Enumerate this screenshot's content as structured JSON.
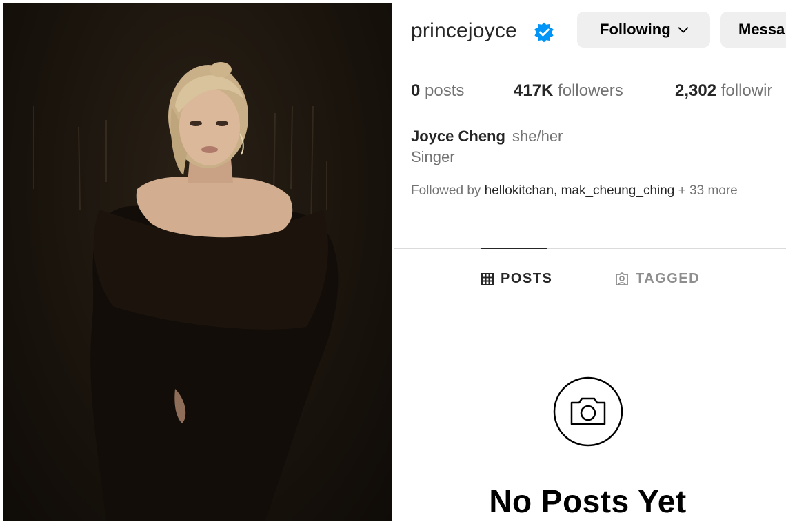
{
  "profile": {
    "username": "princejoyce",
    "verified": true,
    "buttons": {
      "following": "Following",
      "message": "Messa"
    },
    "stats": [
      {
        "value": "0",
        "label": "posts"
      },
      {
        "value": "417K",
        "label": "followers"
      },
      {
        "value": "2,302",
        "label": "followir"
      }
    ],
    "full_name": "Joyce Cheng",
    "pronouns": "she/her",
    "category": "Singer",
    "followed_by": {
      "prefix": "Followed by",
      "users": [
        "hellokitchan",
        "mak_cheung_ching"
      ],
      "separator": ",",
      "more": "+ 33 more"
    }
  },
  "tabs": [
    {
      "label": "POSTS",
      "icon": "grid-icon",
      "active": true
    },
    {
      "label": "TAGGED",
      "icon": "tagged-person-icon",
      "active": false
    }
  ],
  "empty_state": {
    "icon": "camera-icon",
    "text": "No Posts Yet"
  },
  "colors": {
    "verified_badge": "#0095f6",
    "button_bg": "#efefef",
    "secondary_text": "#737373",
    "divider": "#dbdbdb"
  },
  "photo": {
    "subject": "profile-photo"
  }
}
